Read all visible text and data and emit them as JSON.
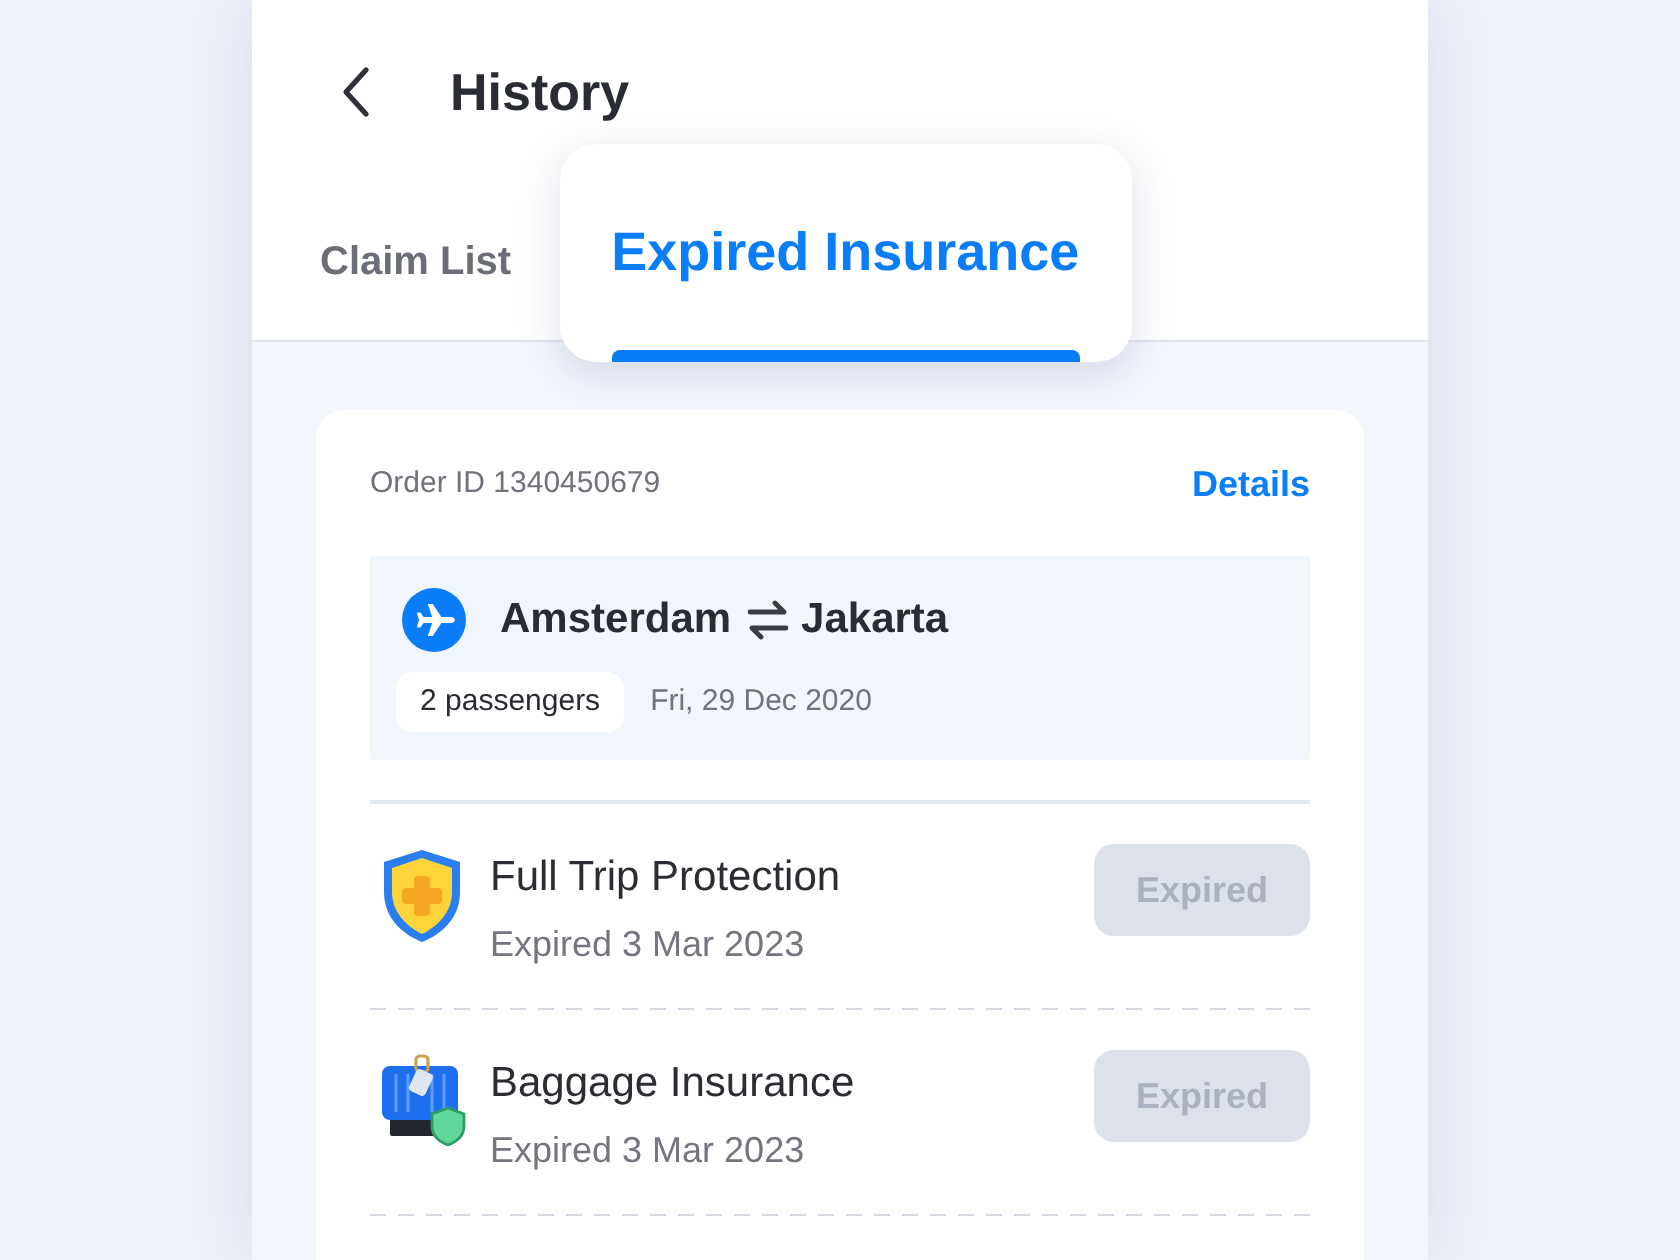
{
  "header": {
    "title": "History"
  },
  "tabs": [
    {
      "label": "Claim List",
      "selected": false
    },
    {
      "label": "Expired Insurance",
      "selected": true
    }
  ],
  "order": {
    "order_id": "Order ID 1340450679",
    "details_link": "Details",
    "route": {
      "from": "Amsterdam",
      "to": "Jakarta",
      "passengers": "2 passengers",
      "date": "Fri, 29 Dec 2020"
    },
    "policies": [
      {
        "kind": "trip",
        "name": "Full Trip Protection",
        "expiry": "Expired 3 Mar 2023",
        "status": "Expired",
        "disabled": true
      },
      {
        "kind": "baggage",
        "name": "Baggage Insurance",
        "expiry": "Expired 3 Mar 2023",
        "status": "Expired",
        "disabled": true
      }
    ]
  }
}
